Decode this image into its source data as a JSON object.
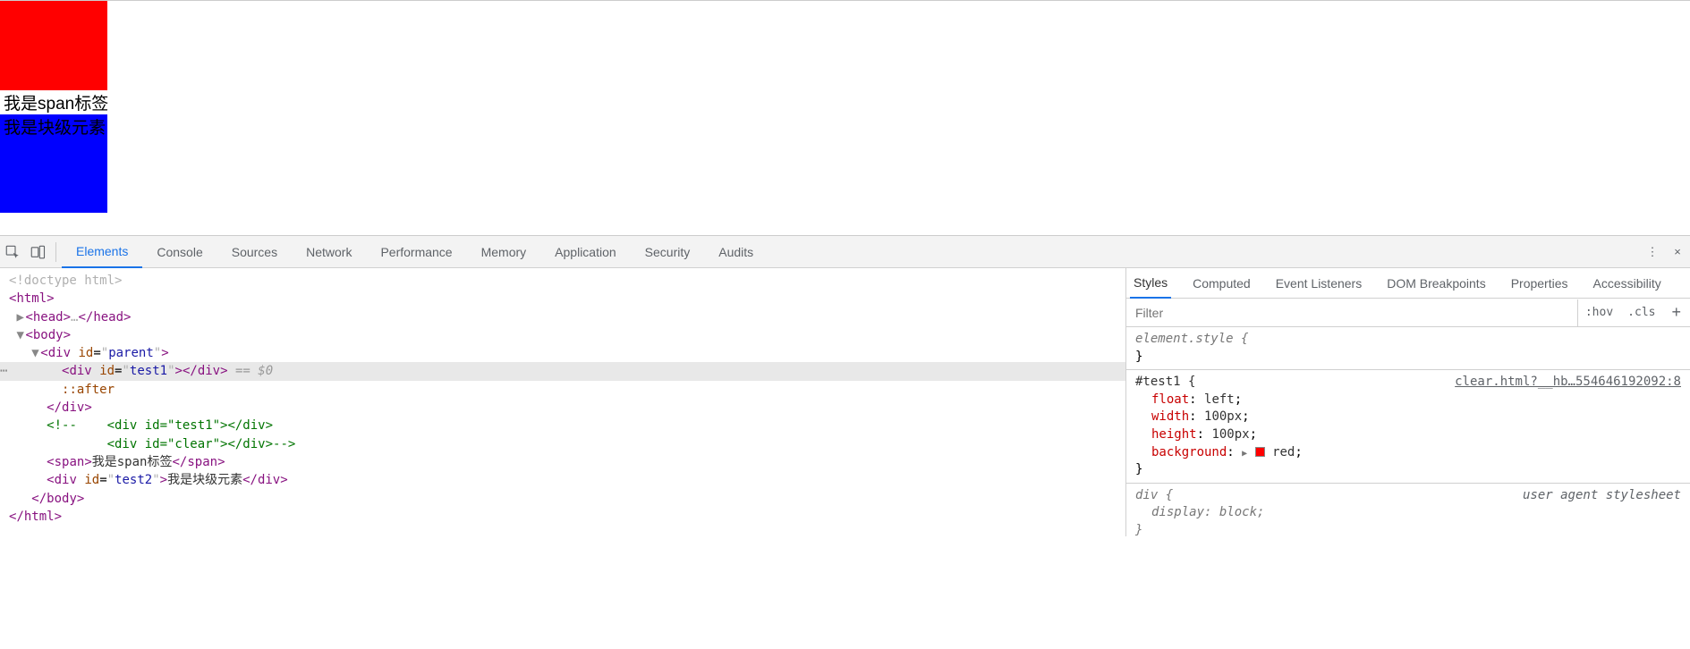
{
  "page": {
    "span_text": "我是span标签",
    "block_text": "我是块级元素"
  },
  "devtools": {
    "tabs": [
      "Elements",
      "Console",
      "Sources",
      "Network",
      "Performance",
      "Memory",
      "Application",
      "Security",
      "Audits"
    ],
    "active_tab": "Elements"
  },
  "elements_tree": {
    "doctype": "<!doctype html>",
    "html_open": "html",
    "head": "head",
    "body_open": "body",
    "div_parent": {
      "tag": "div",
      "attr": "id",
      "val": "parent"
    },
    "div_test1": {
      "tag": "div",
      "attr": "id",
      "val": "test1"
    },
    "selected_suffix": " == $0",
    "after_pseudo": "::after",
    "div_close": "/div",
    "comment": "<!--    <div id=\"test1\"></div>\n          <div id=\"clear\"></div>-->",
    "span_open": "span",
    "span_text": "我是span标签",
    "span_close": "/span",
    "div_test2": {
      "tag": "div",
      "attr": "id",
      "val": "test2",
      "text": "我是块级元素"
    },
    "body_close": "/body",
    "html_close": "/html"
  },
  "styles_panel": {
    "tabs": [
      "Styles",
      "Computed",
      "Event Listeners",
      "DOM Breakpoints",
      "Properties",
      "Accessibility"
    ],
    "active_tab": "Styles",
    "filter_placeholder": "Filter",
    "hov": ":hov",
    "cls": ".cls",
    "rule_element_style": "element.style {",
    "rule_close": "}",
    "rule_test1": {
      "selector": "#test1 {",
      "link": "clear.html?__hb…554646192092:8",
      "props": [
        {
          "name": "float",
          "value": "left"
        },
        {
          "name": "width",
          "value": "100px"
        },
        {
          "name": "height",
          "value": "100px"
        },
        {
          "name": "background",
          "value": "red",
          "swatch": true
        }
      ]
    },
    "rule_div": {
      "selector": "div {",
      "source": "user agent stylesheet",
      "props": [
        {
          "name": "display",
          "value": "block",
          "italic": true
        }
      ]
    }
  }
}
